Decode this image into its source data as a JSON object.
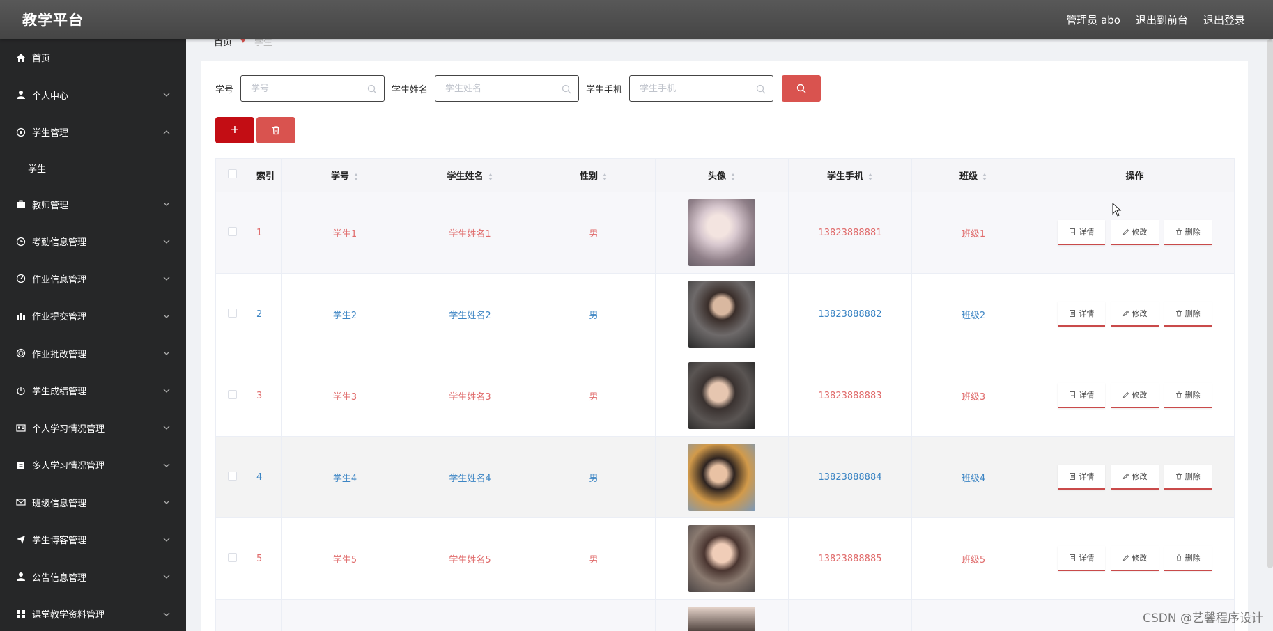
{
  "app": {
    "title": "教学平台"
  },
  "topbar": {
    "user": "管理员 abo",
    "front": "退出到前台",
    "logout": "退出登录"
  },
  "sidebar": {
    "items": [
      {
        "label": "首页",
        "icon": "home-icon"
      },
      {
        "label": "个人中心",
        "icon": "user-icon"
      },
      {
        "label": "学生管理",
        "icon": "settings-icon"
      },
      {
        "label": "学生",
        "icon": ""
      },
      {
        "label": "教师管理",
        "icon": "briefcase-icon"
      },
      {
        "label": "考勤信息管理",
        "icon": "clock-icon"
      },
      {
        "label": "作业信息管理",
        "icon": "dashboard-icon"
      },
      {
        "label": "作业提交管理",
        "icon": "bar-chart-icon"
      },
      {
        "label": "作业批改管理",
        "icon": "circle-icon"
      },
      {
        "label": "学生成绩管理",
        "icon": "power-icon"
      },
      {
        "label": "个人学习情况管理",
        "icon": "id-card-icon"
      },
      {
        "label": "多人学习情况管理",
        "icon": "clipboard-icon"
      },
      {
        "label": "班级信息管理",
        "icon": "mail-icon"
      },
      {
        "label": "学生博客管理",
        "icon": "send-icon"
      },
      {
        "label": "公告信息管理",
        "icon": "user-icon"
      },
      {
        "label": "课堂教学资料管理",
        "icon": "grid-icon"
      }
    ]
  },
  "breadcrumb": {
    "home": "首页",
    "current": "学生"
  },
  "search": {
    "fields": [
      {
        "label": "学号",
        "placeholder": "学号"
      },
      {
        "label": "学生姓名",
        "placeholder": "学生姓名"
      },
      {
        "label": "学生手机",
        "placeholder": "学生手机"
      }
    ]
  },
  "actions": {
    "add": "+"
  },
  "table": {
    "headers": [
      "索引",
      "学号",
      "学生姓名",
      "性别",
      "头像",
      "学生手机",
      "班级",
      "操作"
    ],
    "ops": [
      "详情",
      "修改",
      "删除"
    ],
    "rows": [
      {
        "index": "1",
        "xuehao": "学生1",
        "name": "学生姓名1",
        "gender": "男",
        "phone": "13823888881",
        "class": "班级1"
      },
      {
        "index": "2",
        "xuehao": "学生2",
        "name": "学生姓名2",
        "gender": "男",
        "phone": "13823888882",
        "class": "班级2"
      },
      {
        "index": "3",
        "xuehao": "学生3",
        "name": "学生姓名3",
        "gender": "男",
        "phone": "13823888883",
        "class": "班级3"
      },
      {
        "index": "4",
        "xuehao": "学生4",
        "name": "学生姓名4",
        "gender": "男",
        "phone": "13823888884",
        "class": "班级4"
      },
      {
        "index": "5",
        "xuehao": "学生5",
        "name": "学生姓名5",
        "gender": "男",
        "phone": "13823888885",
        "class": "班级5"
      }
    ]
  },
  "watermark": "CSDN @艺馨程序设计",
  "colors": {
    "accent": "#d9534f",
    "add": "#c30d14",
    "sidebar": "#262728",
    "topbar": "#4a4a4a",
    "red_text": "#e06b6b",
    "blue_text": "#3c85c4"
  }
}
